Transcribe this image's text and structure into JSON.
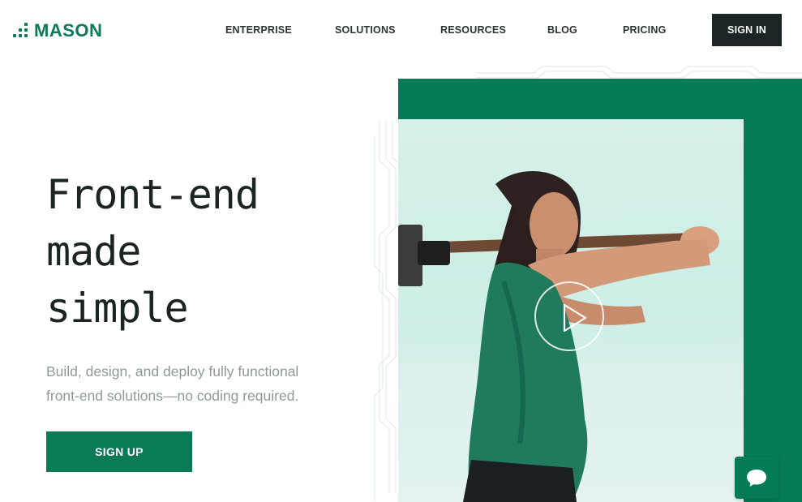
{
  "brand": {
    "name": "MASON",
    "color": "#0b7a57"
  },
  "nav": {
    "items": [
      {
        "label": "ENTERPRISE"
      },
      {
        "label": "SOLUTIONS"
      },
      {
        "label": "RESOURCES"
      },
      {
        "label": "BLOG"
      },
      {
        "label": "PRICING"
      }
    ],
    "signin_label": "SIGN IN"
  },
  "hero": {
    "title_lines": [
      "Front-end",
      "made",
      "simple"
    ],
    "subtitle_lines": [
      "Build, design, and deploy fully functional",
      "front-end solutions—no coding required."
    ],
    "cta_label": "SIGN UP"
  },
  "media": {
    "play_icon": "play-icon",
    "chat_icon": "chat-bubble-icon"
  },
  "colors": {
    "accent": "#0b7a57",
    "dark": "#1b2525",
    "subtext": "#8d9a99"
  }
}
